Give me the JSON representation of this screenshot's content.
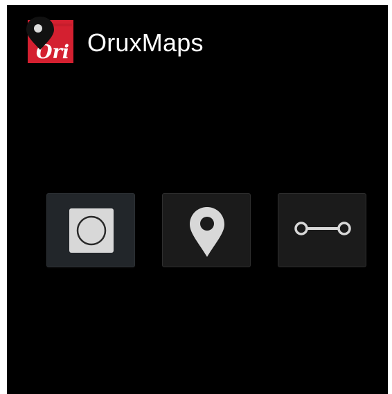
{
  "app": {
    "name": "OruxMaps",
    "logo_text": "Ori",
    "logo_icon": "map-pin-logo-icon"
  },
  "actions": [
    {
      "id": "record",
      "icon": "record-icon",
      "state": "active"
    },
    {
      "id": "waypoint",
      "icon": "map-marker-icon",
      "state": "normal"
    },
    {
      "id": "route",
      "icon": "route-segment-icon",
      "state": "normal"
    }
  ],
  "colors": {
    "background": "#000000",
    "title_text": "#ffffff",
    "logo_red": "#d42030",
    "icon_light": "#d8d8d8",
    "button_active": "#22262a",
    "button_normal": "#1b1b1b"
  }
}
